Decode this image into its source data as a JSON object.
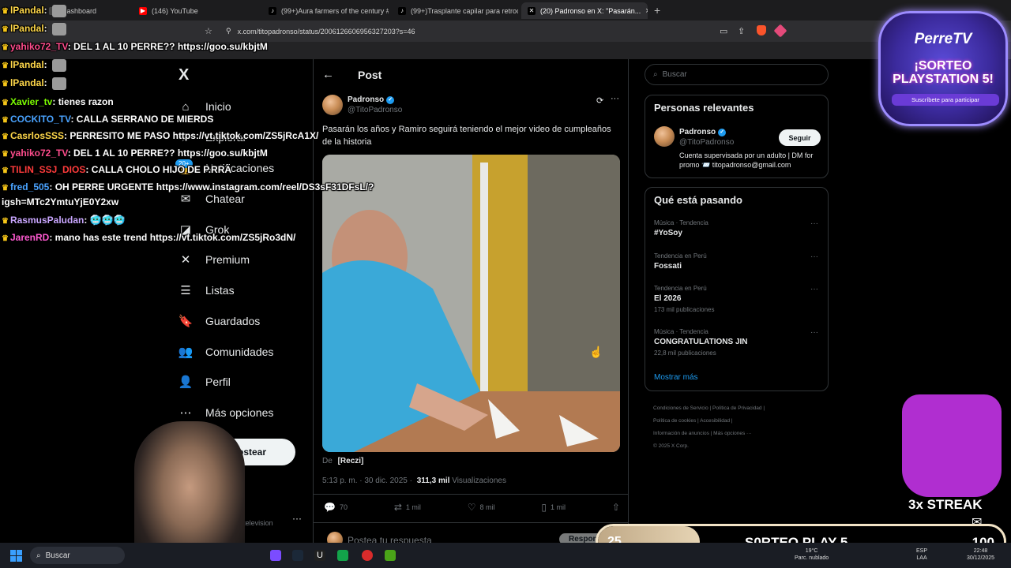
{
  "browser": {
    "tabs": [
      {
        "label": "Dashboard",
        "icon_color": "#444"
      },
      {
        "label": "(146) YouTube",
        "icon_color": "#ff0000"
      },
      {
        "label": "(99+)Aura farmers of the century #a...",
        "icon_color": "#000"
      },
      {
        "label": "(99+)Trasplante capilar para retroce...",
        "icon_color": "#000"
      },
      {
        "label": "(20) Padronso en X: \"Pasarán...",
        "icon_color": "#000"
      }
    ],
    "active_tab_index": 4,
    "new_tab": "+",
    "url": "x.com/titopadronso/status/2006126606956327203?s=46"
  },
  "x_nav": {
    "logo": "X",
    "items": [
      {
        "label": "Inicio",
        "icon": "home-icon",
        "glyph": "⌂"
      },
      {
        "label": "Explorar",
        "icon": "search-icon",
        "glyph": "⌕"
      },
      {
        "label": "Notificaciones",
        "icon": "bell-icon",
        "glyph": "🔔"
      },
      {
        "label": "Chatear",
        "icon": "mail-icon",
        "glyph": "✉"
      },
      {
        "label": "Grok",
        "icon": "grok-icon",
        "glyph": "◪"
      },
      {
        "label": "Premium",
        "icon": "x-premium-icon",
        "glyph": "✕"
      },
      {
        "label": "Listas",
        "icon": "list-icon",
        "glyph": "☰"
      },
      {
        "label": "Guardados",
        "icon": "bookmark-icon",
        "glyph": "🔖"
      },
      {
        "label": "Comunidades",
        "icon": "communities-icon",
        "glyph": "👥"
      },
      {
        "label": "Perfil",
        "icon": "profile-icon",
        "glyph": "👤"
      },
      {
        "label": "Más opciones",
        "icon": "more-options-icon",
        "glyph": "⋯"
      }
    ],
    "notif_badge": "20+",
    "post_button": "Postear",
    "account_handle": "@ruetelevision",
    "account_more": "···"
  },
  "post": {
    "header_title": "Post",
    "author_name": "Padronso",
    "author_handle": "@TitoPadronso",
    "text": "Pasarán los años y Ramiro seguirá teniendo el mejor video de cumpleaños de la historia",
    "from_label": "De",
    "from_user": "[Reczi]",
    "time": "5:13 p. m. · 30 dic. 2025 ·",
    "views_count": "311,3 mil",
    "views_label": "Visualizaciones",
    "replies": "70",
    "reposts": "1 mil",
    "likes": "8 mil",
    "bookmarks": "1 mil",
    "reply_placeholder": "Postea tu respuesta",
    "reply_button": "Responder"
  },
  "sidebar": {
    "search_placeholder": "Buscar",
    "relevant_title": "Personas relevantes",
    "relevant_name": "Padronso",
    "relevant_handle": "@TitoPadronso",
    "relevant_bio": "Cuenta supervisada por un adulto | DM for promo 📨 titopadronso@gmail.com",
    "follow_button": "Seguir",
    "trending_title": "Qué está pasando",
    "trends": [
      {
        "context": "Música · Tendencia",
        "title": "#YoSoy",
        "posts": ""
      },
      {
        "context": "Tendencia en Perú",
        "title": "Fossati",
        "posts": ""
      },
      {
        "context": "Tendencia en Perú",
        "title": "El 2026",
        "posts": "173 mil publicaciones"
      },
      {
        "context": "Música · Tendencia",
        "title": "CONGRATULATIONS JIN",
        "posts": "22,8 mil publicaciones"
      }
    ],
    "show_more": "Mostrar más",
    "footer_line1": "Condiciones de Servicio  |  Política de Privacidad  |",
    "footer_line2": "Política de cookies  |  Accesibilidad  |",
    "footer_line3": "Información de anuncios  |  Más opciones ···",
    "footer_line4": "© 2025 X Corp."
  },
  "chat": [
    {
      "user": "lPandal",
      "msg": "",
      "color": "#ffd84a",
      "emote": true
    },
    {
      "user": "lPandal",
      "msg": "",
      "color": "#ffd84a",
      "emote": true
    },
    {
      "user": "yahiko72_TV",
      "msg": "DEL 1 AL 10 PERRE?? https://goo.su/kbjtM",
      "color": "#ff4d8d",
      "emote": false
    },
    {
      "user": "lPandal",
      "msg": "",
      "color": "#ffd84a",
      "emote": true
    },
    {
      "user": "lPandal",
      "msg": "",
      "color": "#ffd84a",
      "emote": true
    },
    {
      "user": "Xavier_tv",
      "msg": "tienes razon",
      "color": "#7cfc00",
      "emote": false
    },
    {
      "user": "COCKITO_TV",
      "msg": "CALLA SERRANO DE MIERDS",
      "color": "#4aa3ff",
      "emote": false
    },
    {
      "user": "CasrlosSSS",
      "msg": "PERRESITO ME PASO https://vt.tiktok.com/ZS5jRcA1X/",
      "color": "#ffd84a",
      "emote": false
    },
    {
      "user": "yahiko72_TV",
      "msg": "DEL 1 AL 10 PERRE?? https://goo.su/kbjtM",
      "color": "#ff4d8d",
      "emote": false
    },
    {
      "user": "TILIN_SSJ_DIOS",
      "msg": "CALLA CHOLO HIJO DE P.RRA",
      "color": "#ff3b3b",
      "emote": false
    },
    {
      "user": "fred_505",
      "msg": "OH PERRE URGENTE https://www.instagram.com/reel/DS3sF31DFsL/?",
      "color": "#4aa3ff",
      "emote": false
    },
    {
      "user": "",
      "msg": "igsh=MTc2YmtuYjE0Y2xw",
      "color": "#fff",
      "emote": false
    },
    {
      "user": "RasmusPaludan",
      "msg": "🥶🥶🥶",
      "color": "#c9a6ff",
      "emote": false
    },
    {
      "user": "JarenRD",
      "msg": "mano has este trend https://vt.tiktok.com/ZS5jRo3dN/",
      "color": "#ff5ad1",
      "emote": false
    }
  ],
  "overlay": {
    "brand": "PerreTV",
    "giveaway_title": "¡SORTEO PLAYSTATION 5!",
    "subscribe_cta": "Suscríbete para participar",
    "streak": "3x STREAK",
    "goal_current": "25",
    "goal_label": "S0RTEO PLAY 5",
    "goal_target": "100",
    "goal_fraction": 0.25
  },
  "taskbar": {
    "search": "Buscar",
    "temp": "19°C",
    "weather": "Parc. nublado",
    "lang": "ESP",
    "region": "LAA",
    "time": "22:48",
    "date": "30/12/2025"
  },
  "colors": {
    "x_blue": "#1d9bf0",
    "muted": "#71767b",
    "border": "#2f3336"
  }
}
